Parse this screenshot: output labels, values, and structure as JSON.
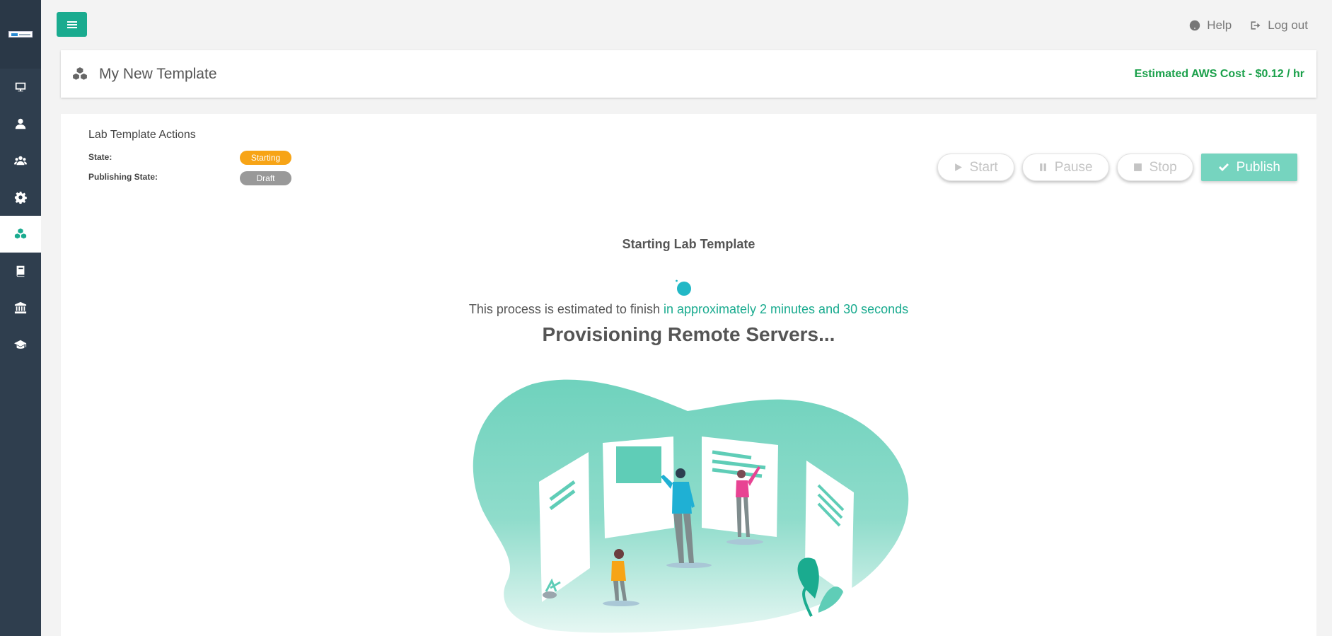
{
  "sidebar": {
    "items": [
      {
        "name": "monitor-icon",
        "active": false
      },
      {
        "name": "user-icon",
        "active": false
      },
      {
        "name": "users-icon",
        "active": false
      },
      {
        "name": "gear-icon",
        "active": false
      },
      {
        "name": "cubes-icon",
        "active": true
      },
      {
        "name": "book-icon",
        "active": false
      },
      {
        "name": "institution-icon",
        "active": false
      },
      {
        "name": "graduation-cap-icon",
        "active": false
      }
    ]
  },
  "header": {
    "help_label": "Help",
    "logout_label": "Log out"
  },
  "title_panel": {
    "title": "My New Template",
    "cost": "Estimated AWS Cost - $0.12 / hr"
  },
  "actions": {
    "title": "Lab Template Actions",
    "state_label": "State:",
    "state_value": "Starting",
    "publishing_label": "Publishing State:",
    "publishing_value": "Draft",
    "buttons": {
      "start": "Start",
      "pause": "Pause",
      "stop": "Stop",
      "publish": "Publish"
    }
  },
  "status": {
    "heading": "Starting Lab Template",
    "estimate_prefix": "This process is estimated to finish ",
    "estimate_time": "in approximately 2 minutes and 30 seconds",
    "message": "Provisioning Remote Servers..."
  },
  "colors": {
    "accent": "#1aab8f",
    "sidebar": "#2f3e4e",
    "cost": "#1aa04a",
    "starting_badge": "#f7a416",
    "draft_badge": "#999999",
    "publish_button": "#76d4bf"
  }
}
